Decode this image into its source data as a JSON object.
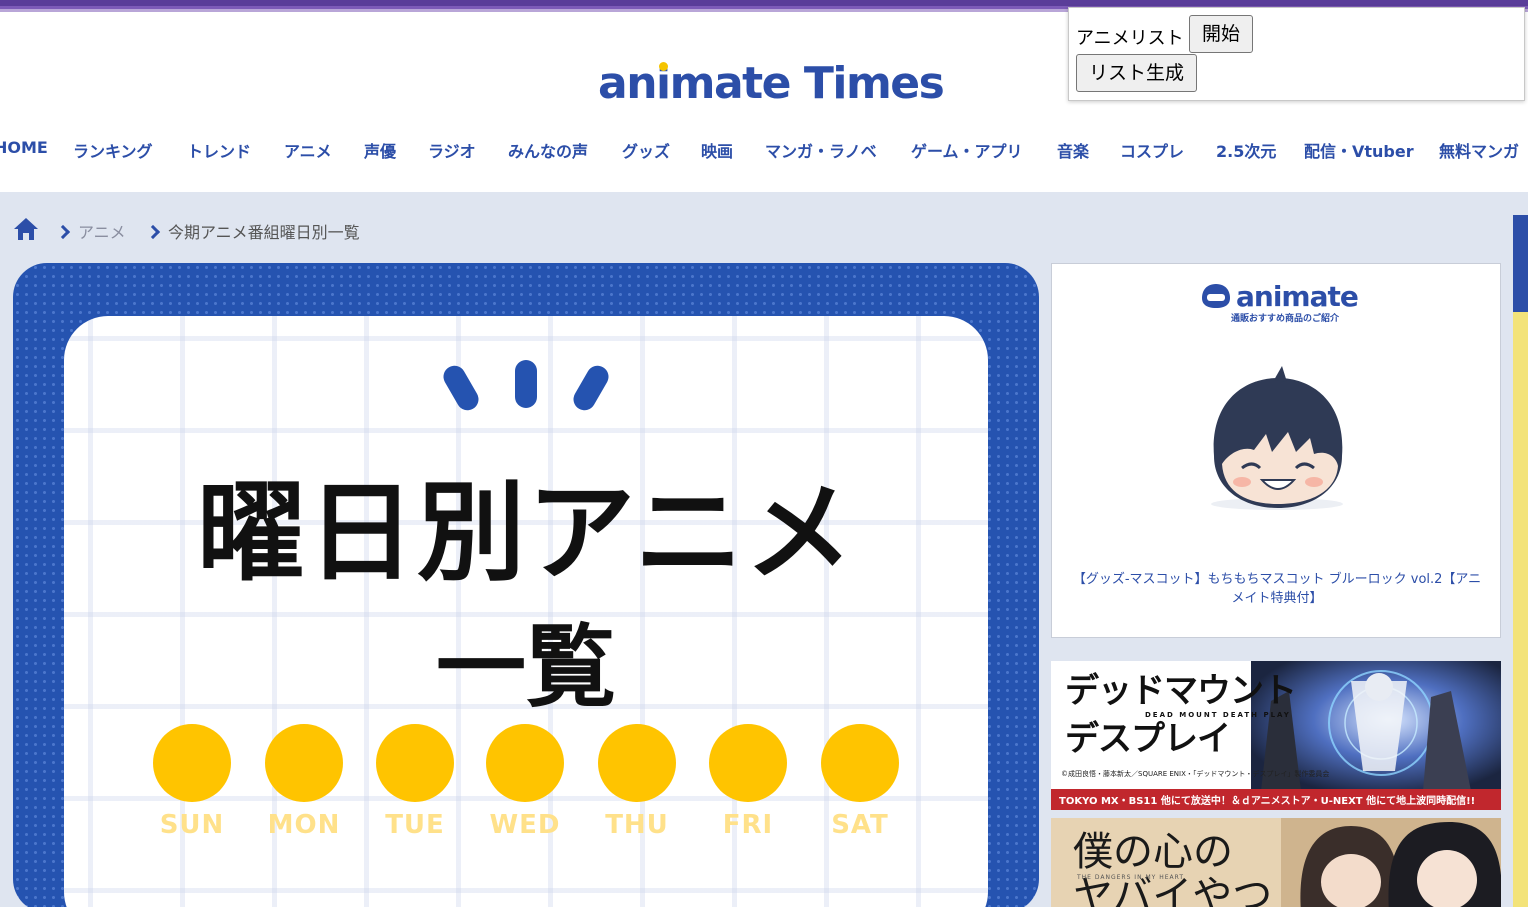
{
  "site": {
    "logo_text_pre": "an",
    "logo_text_i": "i",
    "logo_text_post": "mate Times",
    "accent_color": "#2c4ea8",
    "logo_dot_color": "#f5c400"
  },
  "extension_panel": {
    "label": "アニメリスト",
    "start_button": "開始",
    "generate_button": "リスト生成"
  },
  "nav": {
    "items": [
      "HOME",
      "ランキング",
      "トレンド",
      "アニメ",
      "声優",
      "ラジオ",
      "みんなの声",
      "グッズ",
      "映画",
      "マンガ・ラノベ",
      "ゲーム・アプリ",
      "音楽",
      "コスプレ",
      "2.5次元",
      "配信・Vtuber",
      "無料マンガ"
    ]
  },
  "breadcrumb": {
    "home_icon": "home-icon",
    "items": [
      "アニメ",
      "今期アニメ番組曜日別一覧"
    ]
  },
  "hero": {
    "title_line1": "曜日別アニメ",
    "title_line2": "一覧",
    "days": [
      "SUN",
      "MON",
      "TUE",
      "WED",
      "THU",
      "FRI",
      "SAT"
    ],
    "day_color": "#ffc400",
    "frame_color": "#2553b0"
  },
  "sidebar": {
    "brand": "animate",
    "brand_sub": "通販おすすめ商品のご紹介",
    "product_caption": "【グッズ-マスコット】もちもちマスコット ブルーロック vol.2【アニメイト特典付】",
    "banner1": {
      "title_line1": "デッドマウント",
      "title_line2": "デスプレイ",
      "subtitle": "DEAD MOUNT DEATH PLAY",
      "copyright": "©成田良悟・藤本新太／SQUARE ENIX・「デッドマウント・デスプレイ」製作委員会",
      "footer": "TOKYO MX・BS11 他にて放送中！＆ｄアニメストア・U-NEXT 他にて地上波同時配信!!"
    },
    "banner2": {
      "title_line1": "僕の心の",
      "title_line2": "ヤバイやつ",
      "subtitle": "THE DANGERS IN MY HEART"
    }
  }
}
